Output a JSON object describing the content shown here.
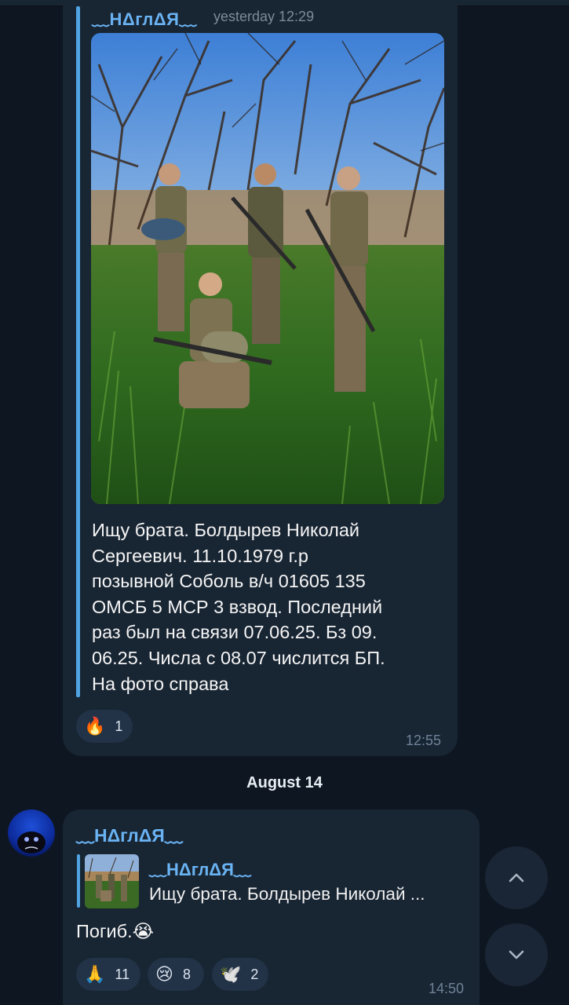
{
  "forwarded_post": {
    "sender": "﹏НΔглΔЯ﹏",
    "sent": "yesterday 12:29",
    "text": "Ищу брата. Болдырев Николай\nСергеевич. 11.10.1979 г.р\nпозывной Соболь в/ч 01605 135\nОМСБ 5 МСР 3 взвод. Последний\nраз был на связи 07.06.25. Бз 09.\n06.25. Числа с 08.07 числится БП.\nНа фото справа",
    "reactions": [
      {
        "emoji": "🔥",
        "count": "1"
      }
    ],
    "time": "12:55"
  },
  "date_separator": "August 14",
  "reply_message": {
    "sender": "﹏НΔглΔЯ﹏",
    "quoted_sender": "﹏НΔглΔЯ﹏",
    "quoted_text": "Ищу брата. Болдырев Николай ...",
    "text": "Погиб.😭",
    "reactions": [
      {
        "emoji": "🙏",
        "count": "11"
      },
      {
        "emoji": "😢",
        "count": "8"
      },
      {
        "emoji": "🕊️",
        "count": "2"
      }
    ],
    "time": "14:50"
  },
  "icons": {
    "scroll_up": "chevron-up-icon",
    "scroll_down": "chevron-down-icon"
  },
  "colors": {
    "background": "#0e1621",
    "bubble": "#182533",
    "accent": "#6ab3f3",
    "reaction_bg": "#223247"
  }
}
